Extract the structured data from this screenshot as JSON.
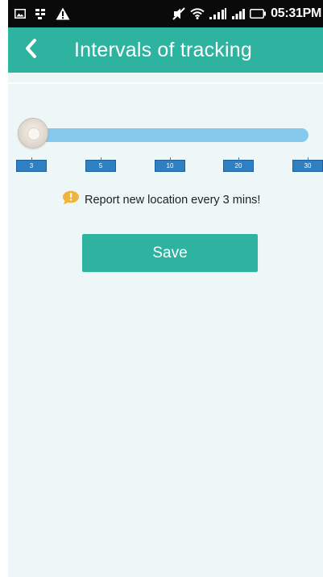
{
  "status_bar": {
    "time": "05:31PM",
    "icons": [
      "image-icon",
      "bb-icon",
      "warning-icon",
      "mute-icon",
      "wifi-icon",
      "data-signal-icon",
      "signal-icon",
      "battery-icon"
    ]
  },
  "app_bar": {
    "title": "Intervals of tracking",
    "back_icon": "chevron-left-icon",
    "background_color": "#2db3a0"
  },
  "slider": {
    "ticks": [
      "3",
      "5",
      "10",
      "20",
      "30"
    ],
    "selected": "3",
    "track_color": "#86c9ec",
    "tick_color": "#2f7fc3"
  },
  "info": {
    "icon": "speech-bubble-alert-icon",
    "message": "Report new location every 3 mins!",
    "icon_color": "#f0b43a"
  },
  "actions": {
    "save_label": "Save",
    "button_color": "#2db3a0"
  }
}
